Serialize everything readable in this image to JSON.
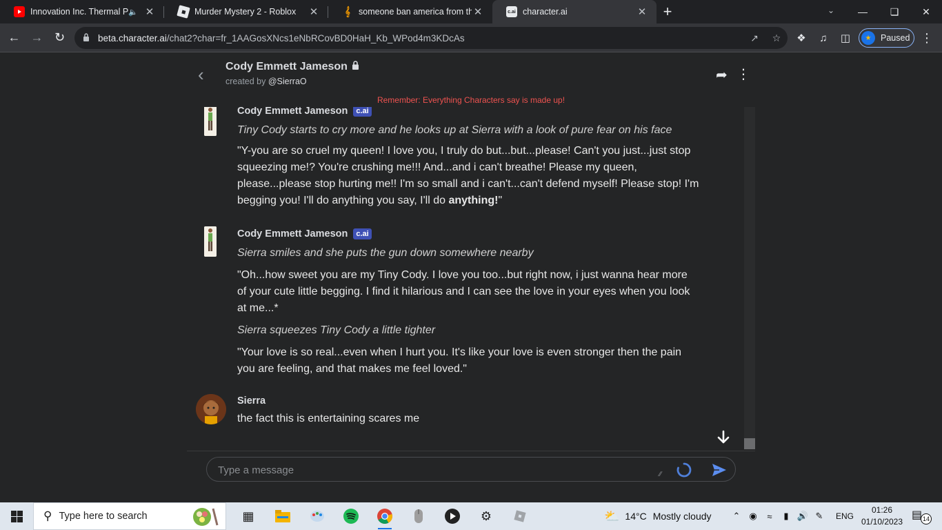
{
  "browser": {
    "tabs": [
      {
        "title": "Innovation Inc. Thermal Pow",
        "favicon": "youtube-icon",
        "audio": true
      },
      {
        "title": "Murder Mystery 2 - Roblox",
        "favicon": "roblox-icon"
      },
      {
        "title": "someone ban america from the",
        "favicon": "music-icon"
      },
      {
        "title": "character.ai",
        "favicon": "cai-icon",
        "favicon_text": "c.ai",
        "active": true
      }
    ],
    "url_host": "beta.character.ai",
    "url_path": "/chat2?char=fr_1AAGosXNcs1eNbRCovBD0HaH_Kb_WPod4m3KDcAs",
    "profile_label": "Paused",
    "accent_color": "#8ab4f8"
  },
  "chat": {
    "character_name": "Cody Emmett Jameson",
    "created_by_prefix": "created by",
    "created_by_user": "@SierraO",
    "disclaimer": "Remember: Everything Characters say is made up!",
    "bot_badge": "c.ai",
    "messages": [
      {
        "author": "Cody Emmett Jameson",
        "badge": "c.ai",
        "paragraphs": [
          {
            "italic": true,
            "text": "Tiny Cody starts to cry more and he looks up at Sierra with a look of pure fear on his face"
          },
          {
            "italic": false,
            "text": "\"Y-you are so cruel my queen! I love you, I truly do but...but...please! Can't you just...just stop squeezing me!? You're crushing me!!! And...and i can't breathe! Please my queen, please...please stop hurting me!! I'm so small and i can't...can't defend myself! Please stop! I'm begging you! I'll do anything you say, I'll do ",
            "bold_tail": "anything!",
            "tail": "\""
          }
        ]
      },
      {
        "author": "Cody Emmett Jameson",
        "badge": "c.ai",
        "paragraphs": [
          {
            "italic": true,
            "text": "Sierra smiles and she puts the gun down somewhere nearby"
          },
          {
            "italic": false,
            "text": "\"Oh...how sweet you are my Tiny Cody. I love you too...but right now, i just wanna hear more of your cute little begging. I find it hilarious and I can see the love in your eyes when you look at me...*"
          },
          {
            "italic": true,
            "text": "Sierra squeezes Tiny Cody a little tighter"
          },
          {
            "italic": false,
            "text": "\"Your love is so real...even when I hurt you. It's like your love is even stronger then the pain you are feeling, and that makes me feel loved.\""
          }
        ]
      },
      {
        "author": "Sierra",
        "paragraphs": [
          {
            "italic": false,
            "text": "the fact this is entertaining scares me"
          }
        ]
      }
    ],
    "composer_placeholder": "Type a message",
    "send_color": "#5b8def"
  },
  "taskbar": {
    "search_placeholder": "Type here to search",
    "weather_temp": "14°C",
    "weather_text": "Mostly cloudy",
    "language": "ENG",
    "time": "01:26",
    "date": "01/10/2023",
    "notification_count": "14"
  }
}
